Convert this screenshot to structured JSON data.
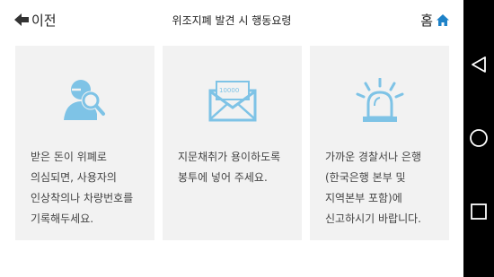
{
  "header": {
    "back_label": "이전",
    "title": "위조지폐 발견 시 행동요령",
    "home_label": "홈"
  },
  "cards": [
    {
      "icon": "person-search-icon",
      "text": "받은 돈이 위폐로 의심되면, 사용자의 인상착의나 차량번호를 기록해두세요."
    },
    {
      "icon": "envelope-banknote-icon",
      "banknote_text": "10000",
      "text": "지문채취가 용이하도록 봉투에 넣어 주세요."
    },
    {
      "icon": "alarm-siren-icon",
      "text": "가까운 경찰서나 은행(한국은행 본부 및 지역본부 포함)에 신고하시기 바랍니다."
    }
  ],
  "colors": {
    "accent": "#1e82c8",
    "icon": "#7ec3e6",
    "card_bg": "#f2f2f2",
    "navbar_bg": "#000000"
  },
  "navbar": {
    "buttons": [
      "nav-back-icon",
      "nav-home-icon",
      "nav-recents-icon"
    ]
  }
}
